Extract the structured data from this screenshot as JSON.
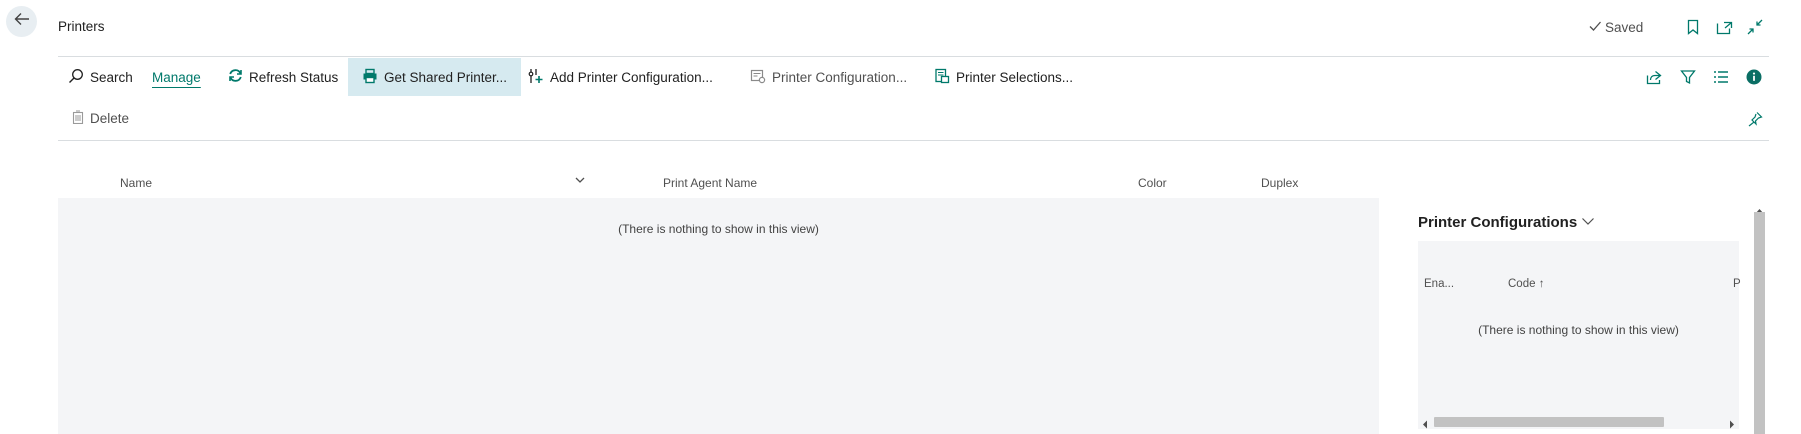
{
  "header": {
    "title": "Printers",
    "saved_label": "Saved",
    "back_icon": "arrow-left-icon",
    "bookmark_icon": "bookmark-icon",
    "open_new_icon": "open-in-new-window-icon",
    "collapse_icon": "collapse-icon"
  },
  "actions": {
    "search": "Search",
    "manage": "Manage",
    "refresh_status": "Refresh Status",
    "get_shared_printer": "Get Shared Printer...",
    "add_printer_configuration": "Add Printer Configuration...",
    "printer_configuration": "Printer Configuration...",
    "printer_selections": "Printer Selections...",
    "delete": "Delete"
  },
  "list": {
    "columns": [
      "Name",
      "Print Agent Name",
      "Color",
      "Duplex"
    ],
    "empty_text": "(There is nothing to show in this view)"
  },
  "factbox": {
    "title": "Printer Configurations",
    "columns": [
      "Ena...",
      "Code",
      "P"
    ],
    "sort_indicator": "↑",
    "empty_text": "(There is nothing to show in this view)"
  },
  "colors": {
    "accent": "#00796b",
    "active_action_bg": "#d6eaf0",
    "grid_bg": "#f4f5f7",
    "info_icon": "#0a6e64"
  }
}
